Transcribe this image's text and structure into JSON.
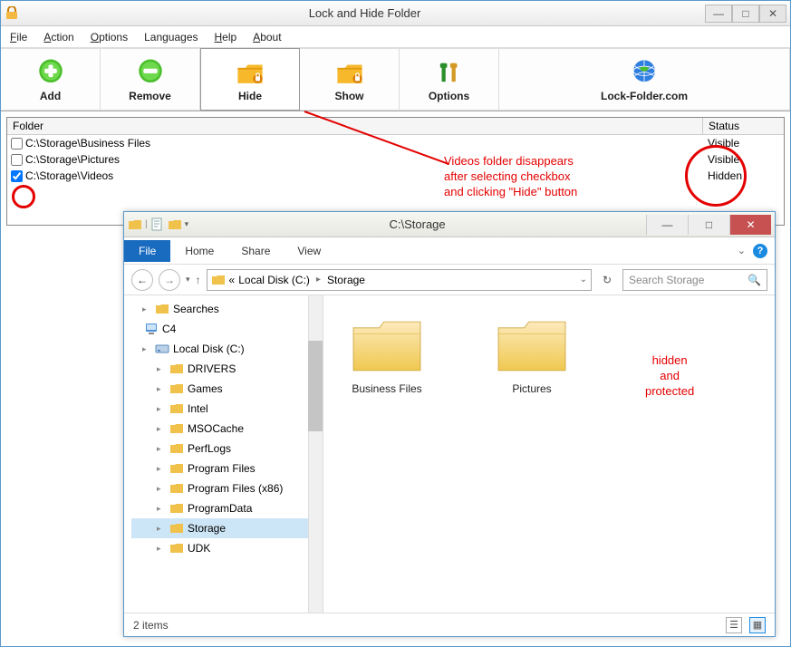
{
  "app": {
    "title": "Lock and Hide Folder",
    "menu": {
      "file": "File",
      "action": "Action",
      "options": "Options",
      "languages": "Languages",
      "help": "Help",
      "about": "About"
    },
    "toolbar": {
      "add": "Add",
      "remove": "Remove",
      "hide": "Hide",
      "show": "Show",
      "options": "Options",
      "website": "Lock-Folder.com"
    },
    "columns": {
      "folder": "Folder",
      "status": "Status"
    },
    "rows": [
      {
        "path": "C:\\Storage\\Business Files",
        "status": "Visible",
        "checked": false
      },
      {
        "path": "C:\\Storage\\Pictures",
        "status": "Visible",
        "checked": false
      },
      {
        "path": "C:\\Storage\\Videos",
        "status": "Hidden",
        "checked": true
      }
    ]
  },
  "explorer": {
    "title": "C:\\Storage",
    "ribbon": {
      "file": "File",
      "home": "Home",
      "share": "Share",
      "view": "View"
    },
    "breadcrumb": {
      "prefix": "«",
      "seg1": "Local Disk (C:)",
      "seg2": "Storage"
    },
    "search_placeholder": "Search Storage",
    "tree": [
      {
        "label": "Searches",
        "indent": 1,
        "icon": "folder"
      },
      {
        "label": "C4",
        "indent": 0,
        "icon": "computer"
      },
      {
        "label": "Local Disk (C:)",
        "indent": 1,
        "icon": "disk"
      },
      {
        "label": "DRIVERS",
        "indent": 2,
        "icon": "folder"
      },
      {
        "label": "Games",
        "indent": 2,
        "icon": "folder"
      },
      {
        "label": "Intel",
        "indent": 2,
        "icon": "folder"
      },
      {
        "label": "MSOCache",
        "indent": 2,
        "icon": "folder"
      },
      {
        "label": "PerfLogs",
        "indent": 2,
        "icon": "folder"
      },
      {
        "label": "Program Files",
        "indent": 2,
        "icon": "folder"
      },
      {
        "label": "Program Files (x86)",
        "indent": 2,
        "icon": "folder"
      },
      {
        "label": "ProgramData",
        "indent": 2,
        "icon": "folder"
      },
      {
        "label": "Storage",
        "indent": 2,
        "icon": "folder",
        "selected": true
      },
      {
        "label": "UDK",
        "indent": 2,
        "icon": "folder"
      }
    ],
    "items": [
      {
        "name": "Business Files"
      },
      {
        "name": "Pictures"
      }
    ],
    "status": "2 items"
  },
  "annotations": {
    "line1": "Videos folder disappears",
    "line2": "after selecting checkbox",
    "line3": "and clicking \"Hide\" button",
    "hidden1": "hidden",
    "hidden2": "and",
    "hidden3": "protected"
  }
}
